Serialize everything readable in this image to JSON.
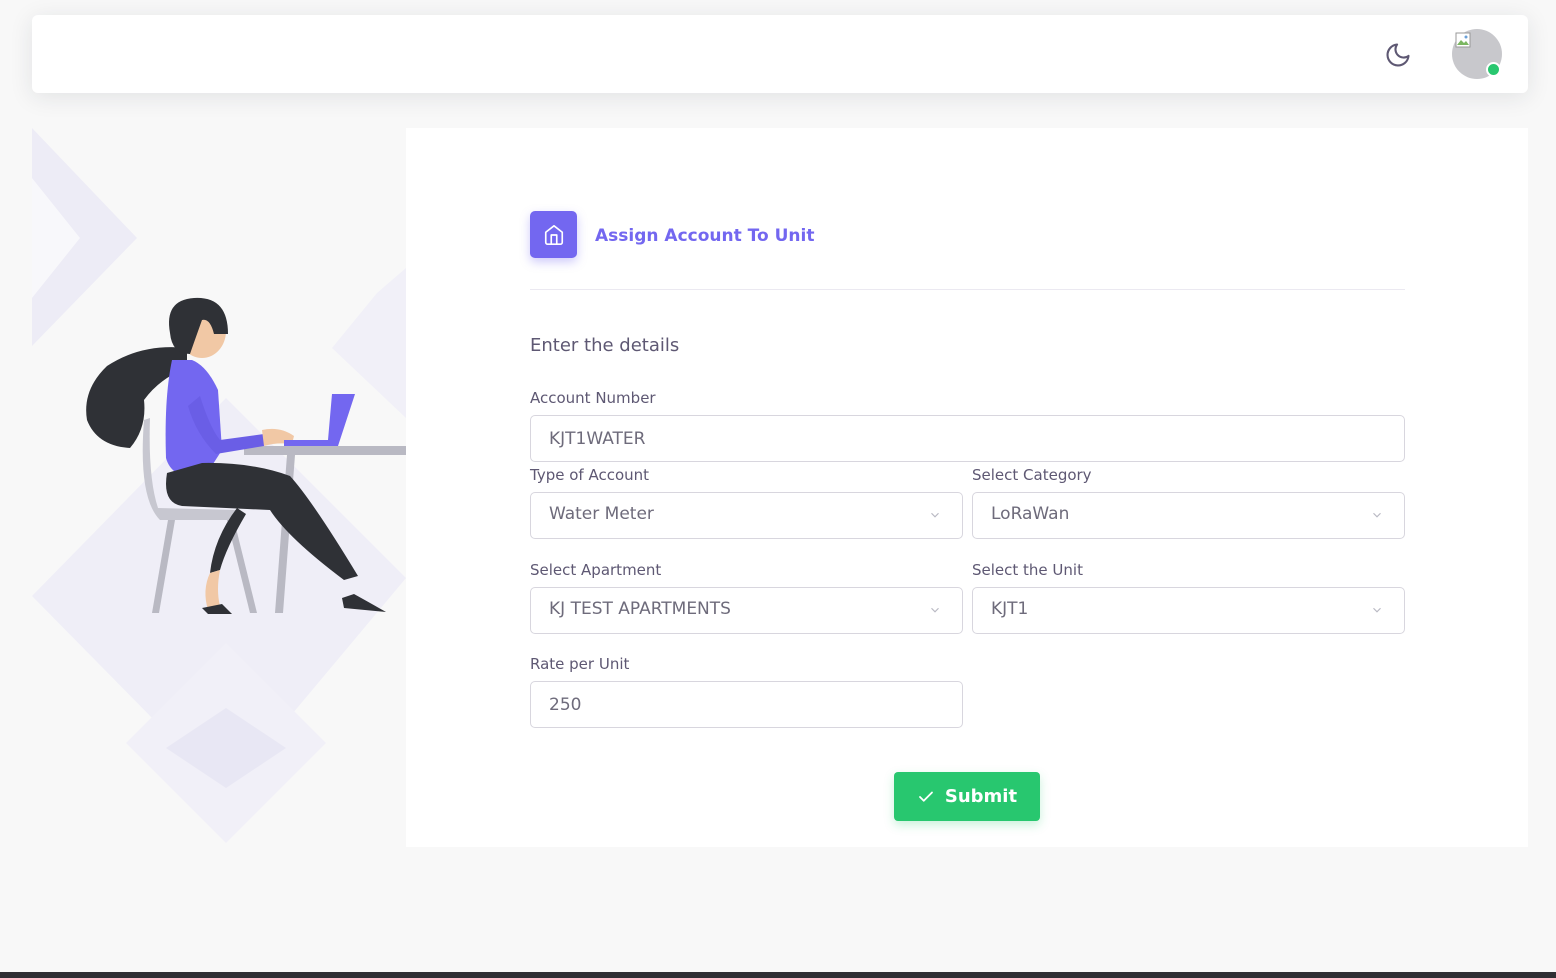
{
  "header": {
    "theme_toggle_icon": "moon-icon",
    "avatar_status": "online",
    "status_color": "#28c76f"
  },
  "form": {
    "title": "Assign Account To Unit",
    "title_icon": "home-icon",
    "subtitle": "Enter the details",
    "account_number": {
      "label": "Account Number",
      "value": "KJT1WATER"
    },
    "account_type": {
      "label": "Type of Account",
      "value": "Water Meter"
    },
    "category": {
      "label": "Select Category",
      "value": "LoRaWan"
    },
    "apartment": {
      "label": "Select Apartment",
      "value": "KJ TEST APARTMENTS"
    },
    "unit": {
      "label": "Select the Unit",
      "value": "KJT1"
    },
    "rate": {
      "label": "Rate per Unit",
      "value": "250"
    },
    "submit_label": "Submit"
  },
  "colors": {
    "primary": "#7367f0",
    "success": "#28c76f",
    "text": "#6e6b7b"
  }
}
